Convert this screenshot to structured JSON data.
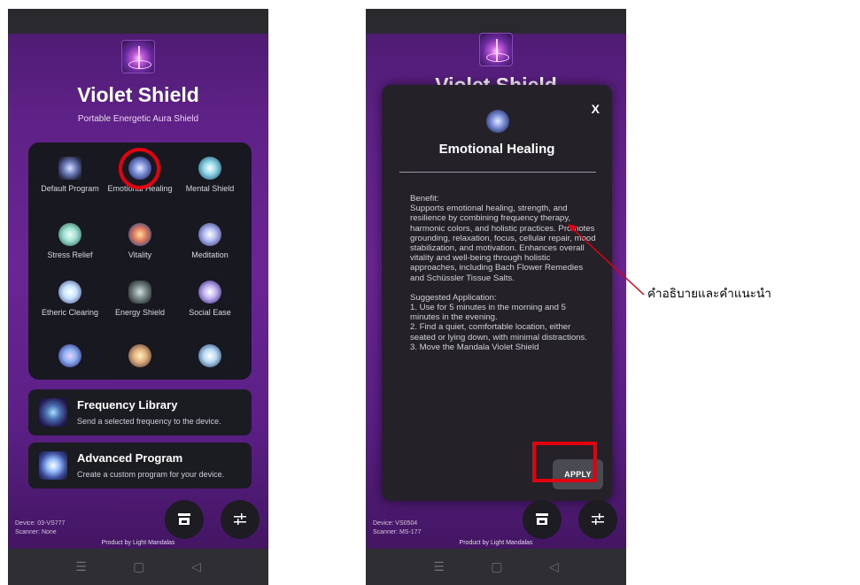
{
  "screen1": {
    "app_title": "Violet Shield",
    "app_subtitle": "Portable Energetic Aura Shield",
    "programs": [
      {
        "label": "Default Program",
        "icon": "default-program-icon",
        "color": "#a8c4ff"
      },
      {
        "label": "Emotional Healing",
        "icon": "emotional-healing-icon",
        "color": "#7a8fd8"
      },
      {
        "label": "Mental Shield",
        "icon": "mental-shield-icon",
        "color": "#8fd4e6"
      },
      {
        "label": "Stress Relief",
        "icon": "stress-relief-icon",
        "color": "#9fe0d0"
      },
      {
        "label": "Vitality",
        "icon": "vitality-icon",
        "color": "#e07a5a"
      },
      {
        "label": "Meditation",
        "icon": "meditation-icon",
        "color": "#b0b8f0"
      },
      {
        "label": "Etheric Clearing",
        "icon": "etheric-clearing-icon",
        "color": "#c8e4ff"
      },
      {
        "label": "Energy Shield",
        "icon": "energy-shield-icon",
        "color": "#a0a8a8"
      },
      {
        "label": "Social Ease",
        "icon": "social-ease-icon",
        "color": "#c0b0f0"
      },
      {
        "label": "",
        "icon": "program-10-icon",
        "color": "#8ab0f0"
      },
      {
        "label": "",
        "icon": "program-11-icon",
        "color": "#e0b080"
      },
      {
        "label": "",
        "icon": "program-12-icon",
        "color": "#b8d8f0"
      }
    ],
    "freq_library": {
      "title": "Frequency Library",
      "description": "Send a selected frequency to the device."
    },
    "advanced_program": {
      "title": "Advanced Program",
      "description": "Create a custom program for your device."
    },
    "device_line": "Device: 03-VS777",
    "scanner_line": "Scanner: None",
    "credit": "Product by Light Mandalas",
    "store_icon": "store-icon",
    "settings_icon": "sliders-icon"
  },
  "screen2": {
    "behind_title": "Violet Shield",
    "modal_close": "X",
    "modal_title": "Emotional Healing",
    "benefit_heading": "Benefit:",
    "benefit_text": "Supports emotional healing, strength, and resilience by combining frequency therapy, harmonic colors, and holistic practices. Promotes grounding, relaxation, focus, cellular repair, mood stabilization, and motivation. Enhances overall vitality and well-being through holistic approaches, including Bach Flower Remedies and Schüssler Tissue Salts.",
    "application_heading": "Suggested Application:",
    "application_steps": [
      "1. Use for 5 minutes in the morning and 5 minutes in the evening.",
      "2. Find a quiet, comfortable location, either seated or lying down, with minimal distractions.",
      "3. Move the Mandala Violet Shield"
    ],
    "apply_label": "APPLY",
    "device_line": "Device: VS0504",
    "scanner_line": "Scanner: MS-177",
    "credit": "Product by Light Mandalas"
  },
  "nav": {
    "menu": "☰",
    "home": "▢",
    "back": "◁"
  },
  "annotation": {
    "text": "คำอธิบายและคำแนะนำ"
  },
  "colors": {
    "highlight": "#e3000f",
    "accent_purple": "#6a2594",
    "panel_dark": "#181820"
  }
}
